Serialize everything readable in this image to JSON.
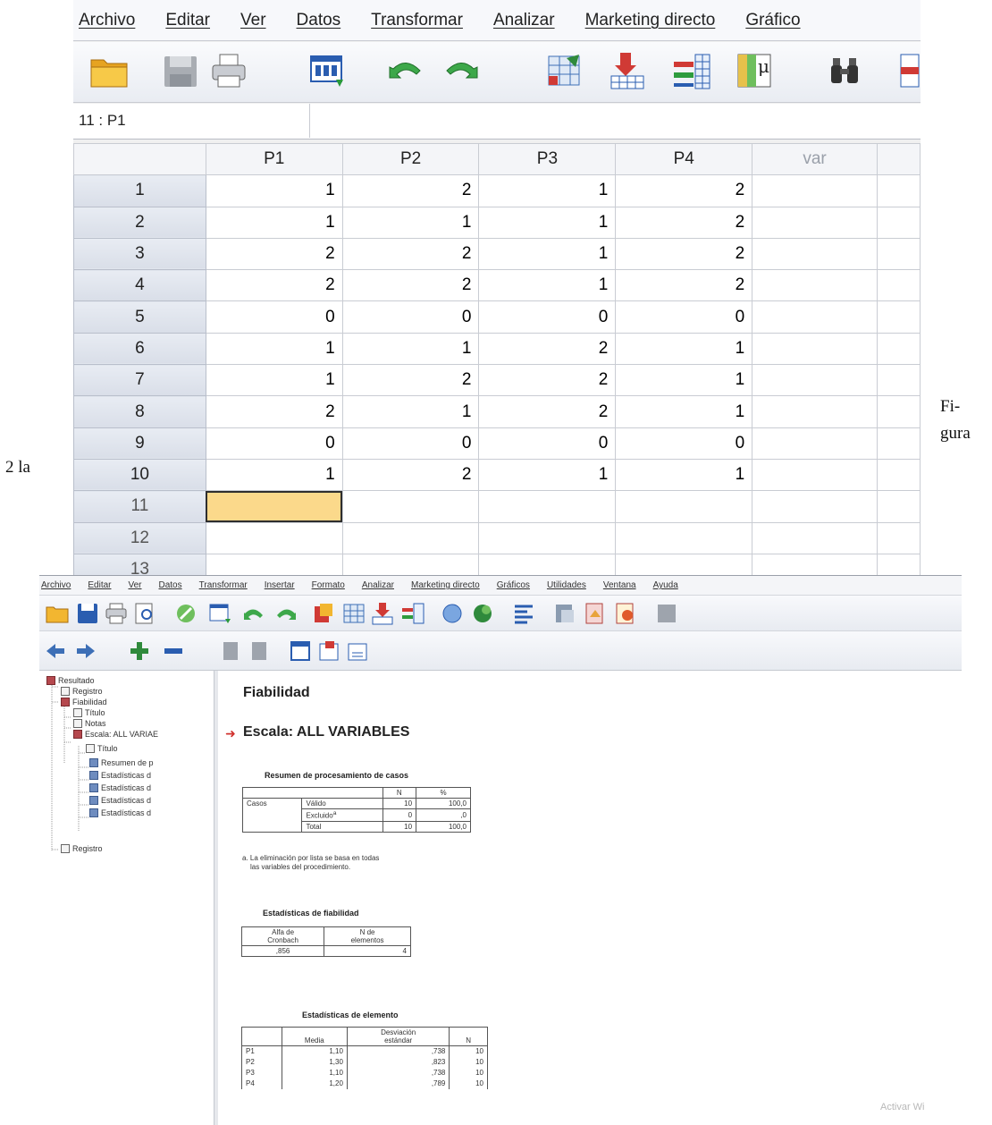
{
  "page": {
    "caption_left": "2 la",
    "caption_right_line1": "Fi-",
    "caption_right_line2": "gura"
  },
  "data_editor": {
    "menu": [
      "Archivo",
      "Editar",
      "Ver",
      "Datos",
      "Transformar",
      "Analizar",
      "Marketing directo",
      "Gráfico"
    ],
    "toolbar_icons": [
      "open-folder-icon",
      "save-icon",
      "print-icon",
      "dialog-recall-icon",
      "undo-icon",
      "redo-icon",
      "goto-case-icon",
      "goto-variable-icon",
      "variables-icon",
      "value-labels-icon",
      "find-icon",
      "insert-cases-icon"
    ],
    "cell_reference": "11 : P1",
    "columns": [
      "P1",
      "P2",
      "P3",
      "P4",
      "var"
    ],
    "rows": [
      {
        "num": "1",
        "values": [
          "1",
          "2",
          "1",
          "2"
        ]
      },
      {
        "num": "2",
        "values": [
          "1",
          "1",
          "1",
          "2"
        ]
      },
      {
        "num": "3",
        "values": [
          "2",
          "2",
          "1",
          "2"
        ]
      },
      {
        "num": "4",
        "values": [
          "2",
          "2",
          "1",
          "2"
        ]
      },
      {
        "num": "5",
        "values": [
          "0",
          "0",
          "0",
          "0"
        ]
      },
      {
        "num": "6",
        "values": [
          "1",
          "1",
          "2",
          "1"
        ]
      },
      {
        "num": "7",
        "values": [
          "1",
          "2",
          "2",
          "1"
        ]
      },
      {
        "num": "8",
        "values": [
          "2",
          "1",
          "2",
          "1"
        ]
      },
      {
        "num": "9",
        "values": [
          "0",
          "0",
          "0",
          "0"
        ]
      },
      {
        "num": "10",
        "values": [
          "1",
          "2",
          "1",
          "1"
        ]
      },
      {
        "num": "11",
        "values": [
          "",
          "",
          "",
          ""
        ]
      },
      {
        "num": "12",
        "values": [
          "",
          "",
          "",
          ""
        ]
      },
      {
        "num": "13",
        "values": [
          "",
          "",
          "",
          ""
        ]
      }
    ]
  },
  "output_viewer": {
    "menu": [
      "Archivo",
      "Editar",
      "Ver",
      "Datos",
      "Transformar",
      "Insertar",
      "Formato",
      "Analizar",
      "Marketing directo",
      "Gráficos",
      "Utilidades",
      "Ventana",
      "Ayuda"
    ],
    "tree": [
      {
        "label": "Resultado",
        "icon": "book"
      },
      {
        "label": "Registro",
        "icon": "page"
      },
      {
        "label": "Fiabilidad",
        "icon": "book"
      },
      {
        "label": "Título",
        "icon": "page"
      },
      {
        "label": "Notas",
        "icon": "page"
      },
      {
        "label": "Escala: ALL VARIAE",
        "icon": "book"
      },
      {
        "label": "Título",
        "icon": "page"
      },
      {
        "label": "Resumen de p",
        "icon": "chart"
      },
      {
        "label": "Estadísticas d",
        "icon": "chart"
      },
      {
        "label": "Estadísticas d",
        "icon": "chart"
      },
      {
        "label": "Estadísticas d",
        "icon": "chart"
      },
      {
        "label": "Estadísticas d",
        "icon": "chart"
      },
      {
        "label": "Registro",
        "icon": "page"
      }
    ],
    "heading": "Fiabilidad",
    "subheading": "Escala: ALL VARIABLES",
    "case_summary": {
      "title": "Resumen de procesamiento de casos",
      "col_n": "N",
      "col_pct": "%",
      "group_label": "Casos",
      "rows": [
        {
          "label": "Válido",
          "n": "10",
          "pct": "100,0"
        },
        {
          "label": "Excluido",
          "sup": "a",
          "n": "0",
          "pct": ",0"
        },
        {
          "label": "Total",
          "n": "10",
          "pct": "100,0"
        }
      ],
      "footnote_line1": "a. La eliminación por lista se basa en todas",
      "footnote_line2": "las variables del procedimiento."
    },
    "reliability": {
      "title": "Estadísticas de fiabilidad",
      "col1_line1": "Alfa de",
      "col1_line2": "Cronbach",
      "col2_line1": "N de",
      "col2_line2": "elementos",
      "alpha": ",856",
      "n_items": "4"
    },
    "item_stats": {
      "title": "Estadísticas de elemento",
      "col_mean": "Media",
      "col_sd_line1": "Desviación",
      "col_sd_line2": "estándar",
      "col_n": "N",
      "rows": [
        {
          "item": "P1",
          "mean": "1,10",
          "sd": ",738",
          "n": "10"
        },
        {
          "item": "P2",
          "mean": "1,30",
          "sd": ",823",
          "n": "10"
        },
        {
          "item": "P3",
          "mean": "1,10",
          "sd": ",738",
          "n": "10"
        },
        {
          "item": "P4",
          "mean": "1,20",
          "sd": ",789",
          "n": "10"
        }
      ]
    }
  },
  "watermark": "Activar Wi"
}
